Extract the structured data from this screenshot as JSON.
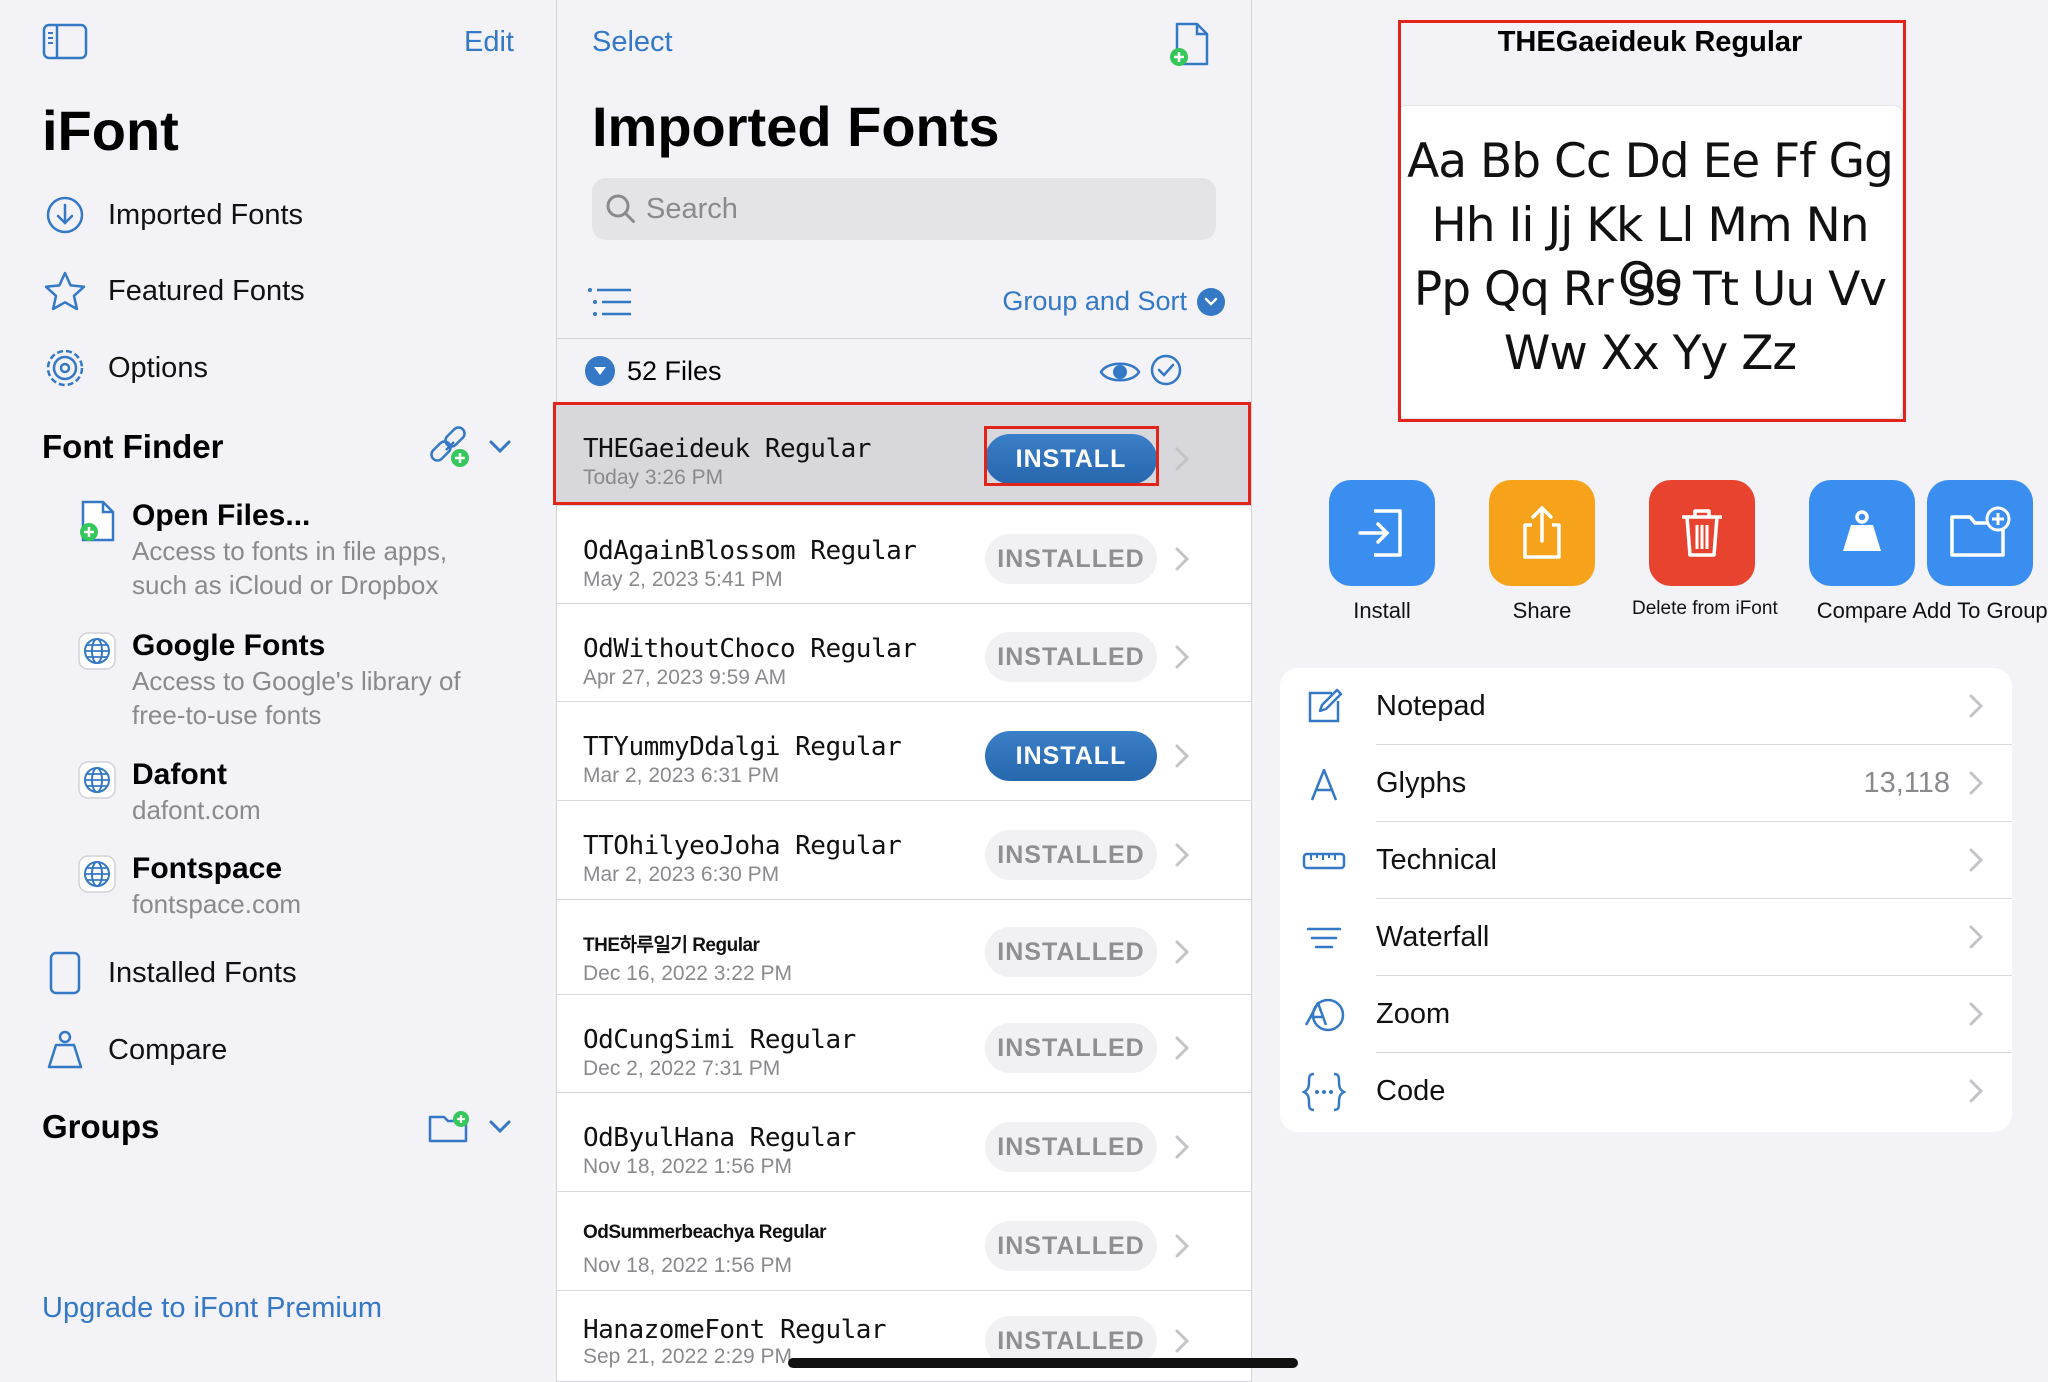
{
  "sidebar": {
    "edit_label": "Edit",
    "app_title": "iFont",
    "nav": [
      {
        "label": "Imported Fonts",
        "icon": "arrow-down-circle-icon"
      },
      {
        "label": "Featured Fonts",
        "icon": "star-icon"
      },
      {
        "label": "Options",
        "icon": "gear-icon"
      }
    ],
    "font_finder": {
      "title": "Font Finder",
      "items": [
        {
          "title": "Open Files...",
          "desc": "Access to fonts in file apps, such as iCloud or Dropbox",
          "icon": "file-plus-icon"
        },
        {
          "title": "Google Fonts",
          "desc": "Access to Google's library of free-to-use fonts",
          "icon": "globe-icon"
        },
        {
          "title": "Dafont",
          "desc": "dafont.com",
          "icon": "globe-icon"
        },
        {
          "title": "Fontspace",
          "desc": "fontspace.com",
          "icon": "globe-icon"
        }
      ]
    },
    "nav2": [
      {
        "label": "Installed Fonts",
        "icon": "tablet-icon"
      },
      {
        "label": "Compare",
        "icon": "scale-icon"
      }
    ],
    "groups_title": "Groups",
    "upgrade_label": "Upgrade to iFont Premium"
  },
  "list": {
    "select_label": "Select",
    "title": "Imported Fonts",
    "search_placeholder": "Search",
    "group_sort_label": "Group and Sort",
    "files_count": "52 Files",
    "rows": [
      {
        "name": "THEGaeideuk Regular",
        "date": "Today 3:26 PM",
        "status": "INSTALL"
      },
      {
        "name": "OdAgainBlossom Regular",
        "date": "May 2, 2023 5:41 PM",
        "status": "INSTALLED"
      },
      {
        "name": "OdWithoutChoco Regular",
        "date": "Apr 27, 2023 9:59 AM",
        "status": "INSTALLED"
      },
      {
        "name": "TTYummyDdalgi Regular",
        "date": "Mar 2, 2023 6:31 PM",
        "status": "INSTALL"
      },
      {
        "name": "TTOhilyeoJoha Regular",
        "date": "Mar 2, 2023 6:30 PM",
        "status": "INSTALLED"
      },
      {
        "name": "THE하루일기 Regular",
        "date": "Dec 16, 2022 3:22 PM",
        "status": "INSTALLED"
      },
      {
        "name": "OdCungSimi Regular",
        "date": "Dec 2, 2022 7:31 PM",
        "status": "INSTALLED"
      },
      {
        "name": "OdByulHana Regular",
        "date": "Nov 18, 2022 1:56 PM",
        "status": "INSTALLED"
      },
      {
        "name": "OdSummerbeachya Regular",
        "date": "Nov 18, 2022 1:56 PM",
        "status": "INSTALLED"
      },
      {
        "name": "HanazomeFont Regular",
        "date": "Sep 21, 2022 2:29 PM",
        "status": "INSTALLED"
      }
    ]
  },
  "detail": {
    "preview_title": "THEGaeideuk Regular",
    "preview_lines": [
      "Aa Bb Cc Dd Ee Ff Gg",
      "Hh Ii Jj Kk Ll Mm Nn Oo",
      "Pp Qq Rr Ss Tt Uu Vv",
      "Ww Xx Yy Zz"
    ],
    "actions": [
      {
        "label": "Install",
        "color": "#3a8ef0"
      },
      {
        "label": "Share",
        "color": "#f7a21b"
      },
      {
        "label": "Delete from iFont",
        "color": "#e8432f"
      },
      {
        "label": "Compare",
        "color": "#3a8ef0"
      },
      {
        "label": "Add To Group",
        "color": "#3a8ef0"
      }
    ],
    "menu": [
      {
        "label": "Notepad",
        "value": "",
        "icon": "compose-icon"
      },
      {
        "label": "Glyphs",
        "value": "13,118",
        "icon": "letter-a-icon"
      },
      {
        "label": "Technical",
        "value": "",
        "icon": "ruler-icon"
      },
      {
        "label": "Waterfall",
        "value": "",
        "icon": "lines-icon"
      },
      {
        "label": "Zoom",
        "value": "",
        "icon": "zoom-icon"
      },
      {
        "label": "Code",
        "value": "",
        "icon": "code-braces-icon"
      }
    ]
  },
  "colors": {
    "accent": "#3478c6",
    "highlight": "#e1251b"
  }
}
